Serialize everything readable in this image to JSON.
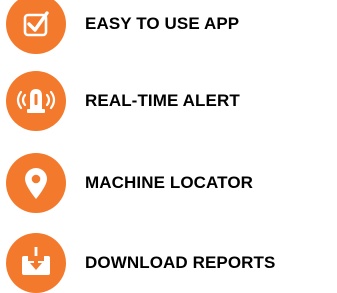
{
  "colors": {
    "accent": "#F37A2C",
    "icon_glyph": "#FFFFFF",
    "text": "#000000"
  },
  "features": [
    {
      "icon": "checkbox-icon",
      "label": "EASY TO USE APP"
    },
    {
      "icon": "alarm-beacon-icon",
      "label": "REAL-TIME ALERT"
    },
    {
      "icon": "map-pin-icon",
      "label": "MACHINE LOCATOR"
    },
    {
      "icon": "download-tray-icon",
      "label": "DOWNLOAD REPORTS"
    }
  ]
}
